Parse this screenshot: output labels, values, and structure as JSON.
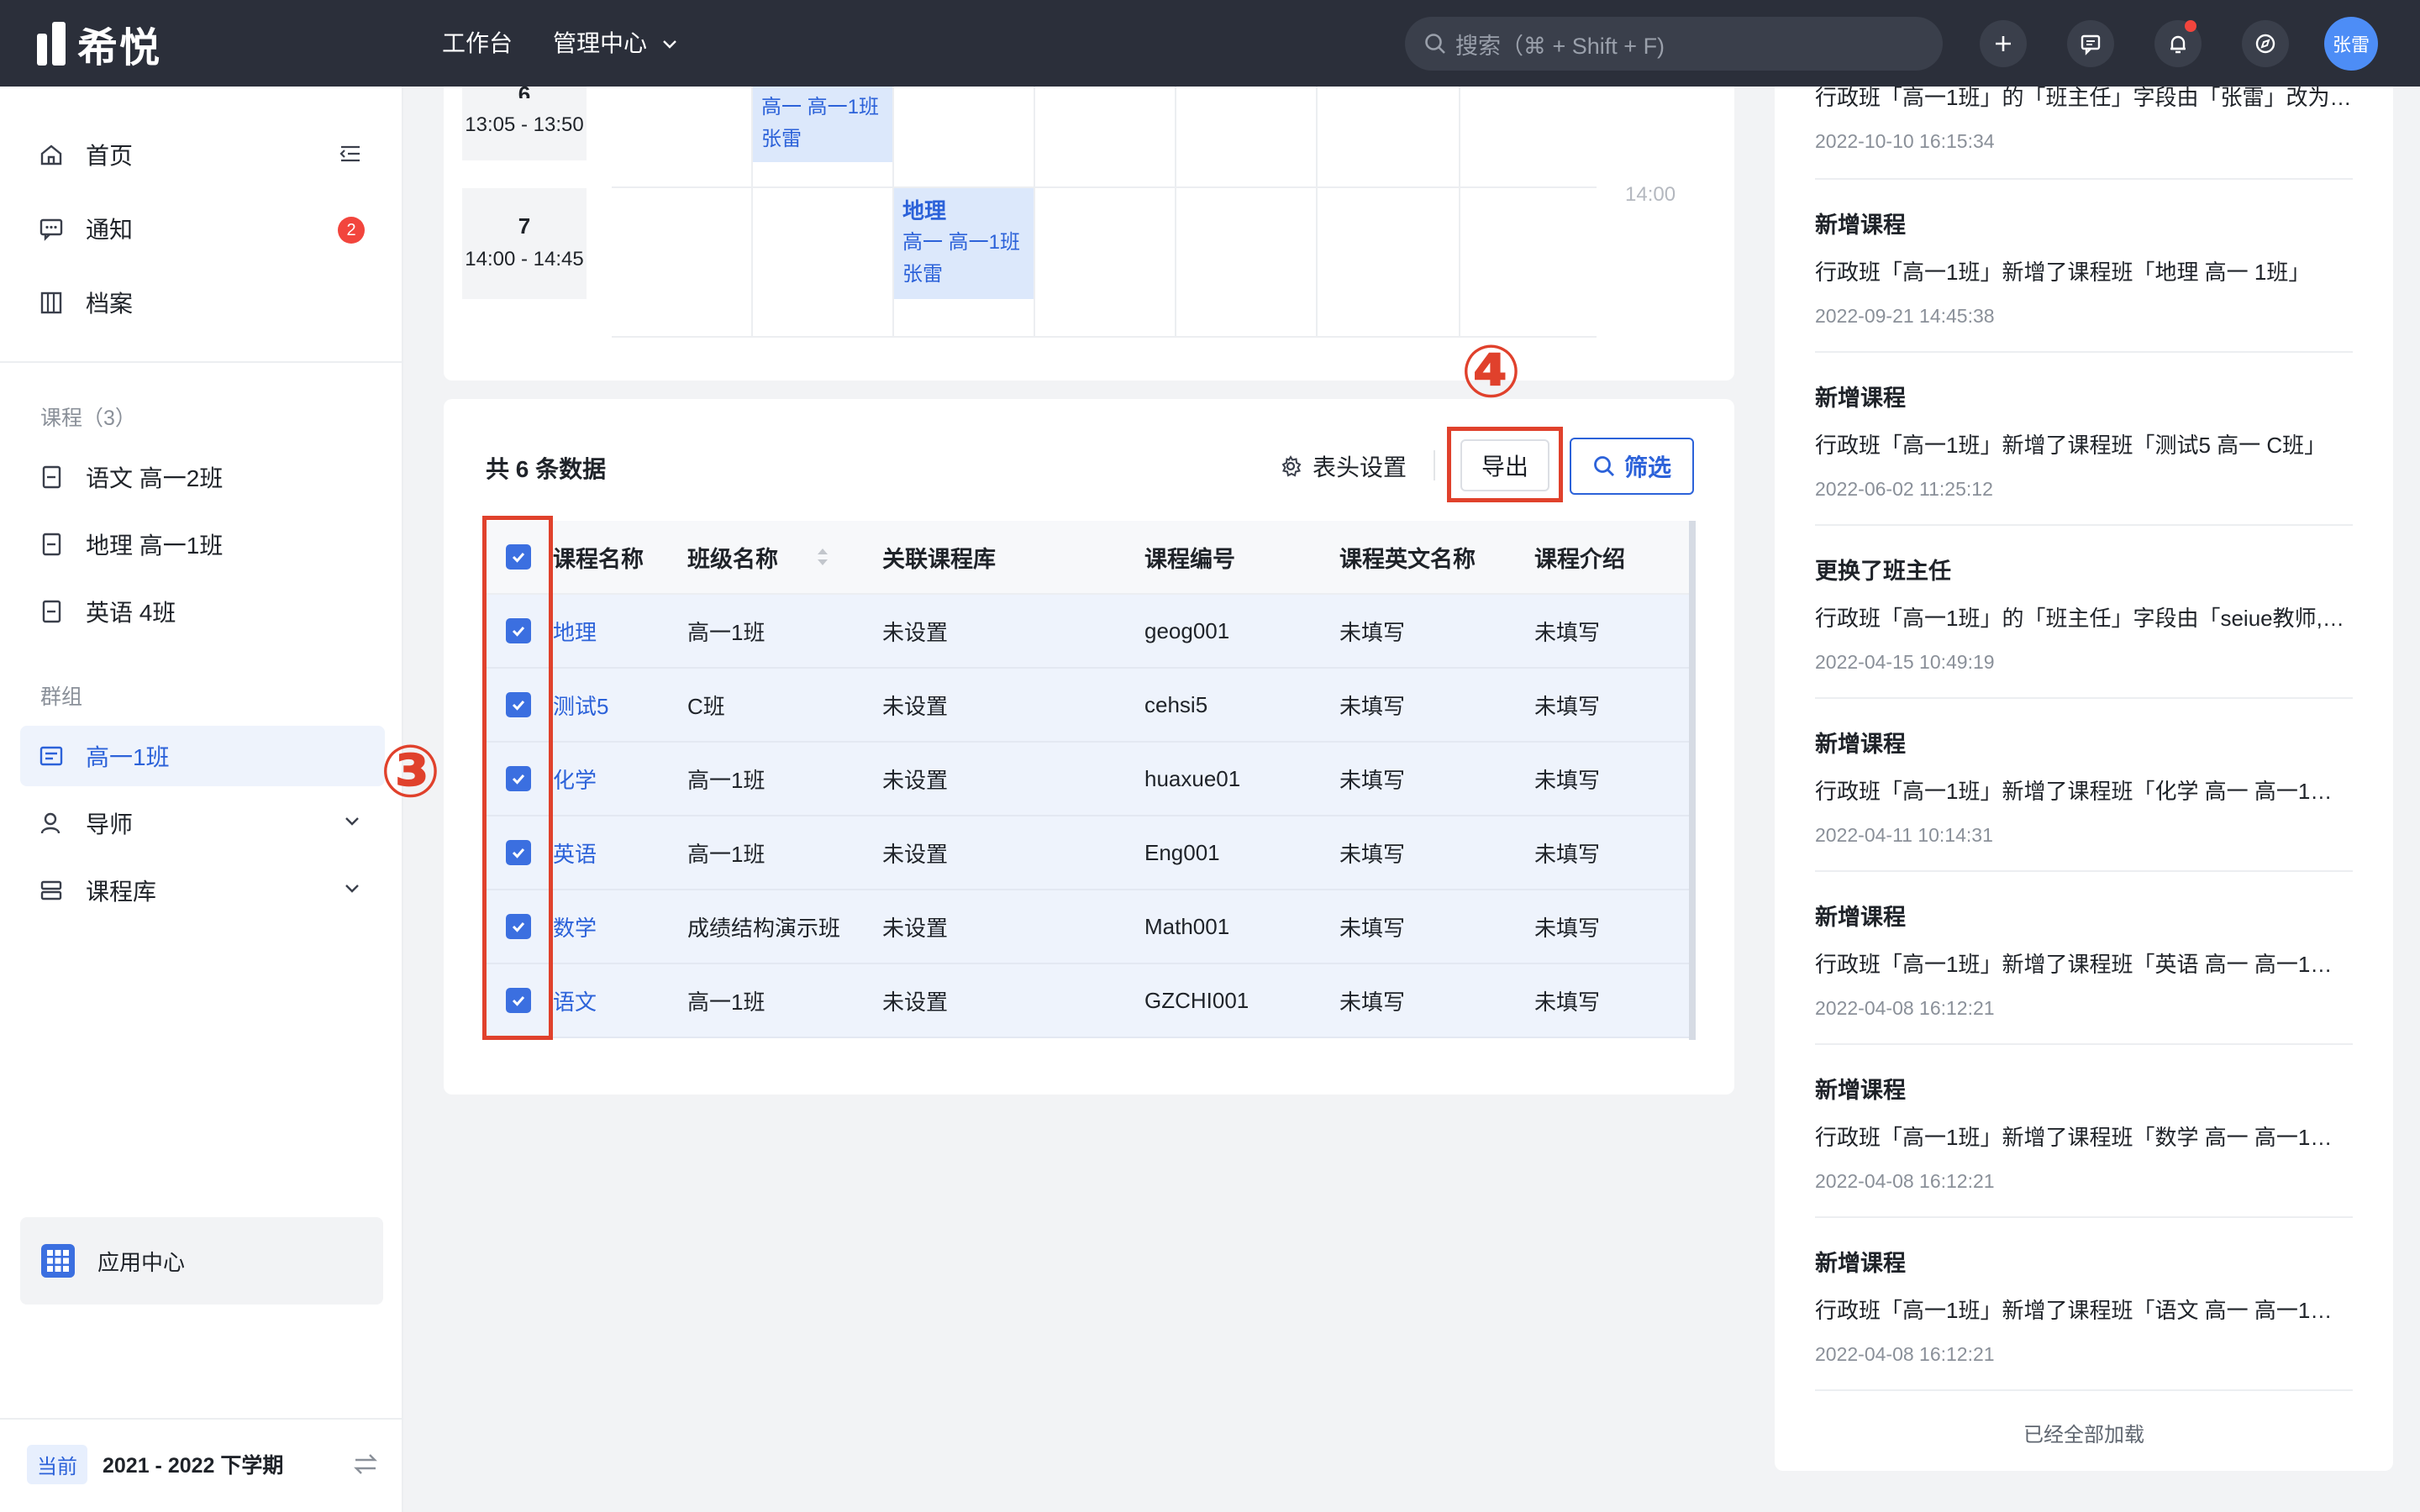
{
  "app": {
    "logo_text": "希悦"
  },
  "topbar": {
    "nav": [
      "工作台",
      "管理中心"
    ],
    "search_placeholder": "搜索（⌘ + Shift + F)",
    "avatar": "张雷"
  },
  "sidebar": {
    "main": [
      {
        "label": "首页",
        "icon": "home-icon"
      },
      {
        "label": "通知",
        "icon": "message-icon",
        "badge": "2"
      },
      {
        "label": "档案",
        "icon": "archive-icon"
      }
    ],
    "courses_title": "课程（3）",
    "courses": [
      "语文 高一2班",
      "地理 高一1班",
      "英语 4班"
    ],
    "groups_title": "群组",
    "groups": [
      {
        "label": "高一1班",
        "active": true
      },
      {
        "label": "导师"
      },
      {
        "label": "课程库"
      }
    ],
    "app_center": "应用中心",
    "term_tag": "当前",
    "term": "2021 - 2022 下学期"
  },
  "schedule": {
    "periods": [
      {
        "no": "6",
        "time": "13:05 - 13:50"
      },
      {
        "no": "7",
        "time": "14:00 - 14:45"
      }
    ],
    "lessons": [
      {
        "subject": "",
        "classes": "高一  高一1班",
        "teacher": "张雷"
      },
      {
        "subject": "地理",
        "classes": "高一  高一1班",
        "teacher": "张雷"
      }
    ],
    "time_mark": "14:00"
  },
  "table": {
    "total": "共 6 条数据",
    "column_settings": "表头设置",
    "export": "导出",
    "filter": "筛选",
    "columns": [
      "课程名称",
      "班级名称",
      "关联课程库",
      "课程编号",
      "课程英文名称",
      "课程介绍"
    ],
    "rows": [
      {
        "name": "地理",
        "class": "高一1班",
        "lib": "未设置",
        "code": "geog001",
        "en": "未填写",
        "intro": "未填写"
      },
      {
        "name": "测试5",
        "class": "C班",
        "lib": "未设置",
        "code": "cehsi5",
        "en": "未填写",
        "intro": "未填写"
      },
      {
        "name": "化学",
        "class": "高一1班",
        "lib": "未设置",
        "code": "huaxue01",
        "en": "未填写",
        "intro": "未填写"
      },
      {
        "name": "英语",
        "class": "高一1班",
        "lib": "未设置",
        "code": "Eng001",
        "en": "未填写",
        "intro": "未填写"
      },
      {
        "name": "数学",
        "class": "成绩结构演示班",
        "lib": "未设置",
        "code": "Math001",
        "en": "未填写",
        "intro": "未填写"
      },
      {
        "name": "语文",
        "class": "高一1班",
        "lib": "未设置",
        "code": "GZCHI001",
        "en": "未填写",
        "intro": "未填写"
      }
    ],
    "annotation_3": "③",
    "annotation_4": "④"
  },
  "activity": {
    "items": [
      {
        "title": "",
        "desc": "行政班「高一1班」的「班主任」字段由「张雷」改为…",
        "time": "2022-10-10 16:15:34"
      },
      {
        "title": "新增课程",
        "desc": "行政班「高一1班」新增了课程班「地理 高一 1班」",
        "time": "2022-09-21 14:45:38"
      },
      {
        "title": "新增课程",
        "desc": "行政班「高一1班」新增了课程班「测试5 高一 C班」",
        "time": "2022-06-02 11:25:12"
      },
      {
        "title": "更换了班主任",
        "desc": "行政班「高一1班」的「班主任」字段由「seiue教师,…",
        "time": "2022-04-15 10:49:19"
      },
      {
        "title": "新增课程",
        "desc": "行政班「高一1班」新增了课程班「化学 高一 高一1…",
        "time": "2022-04-11 10:14:31"
      },
      {
        "title": "新增课程",
        "desc": "行政班「高一1班」新增了课程班「英语 高一 高一1…",
        "time": "2022-04-08 16:12:21"
      },
      {
        "title": "新增课程",
        "desc": "行政班「高一1班」新增了课程班「数学 高一 高一1…",
        "time": "2022-04-08 16:12:21"
      },
      {
        "title": "新增课程",
        "desc": "行政班「高一1班」新增了课程班「语文 高一 高一1…",
        "time": "2022-04-08 16:12:21"
      }
    ],
    "loaded": "已经全部加载"
  },
  "colors": {
    "accent": "#2c62d9",
    "topbar": "#2b2f3a",
    "annotation": "#e0412c",
    "selected_row": "#eef3fc"
  }
}
